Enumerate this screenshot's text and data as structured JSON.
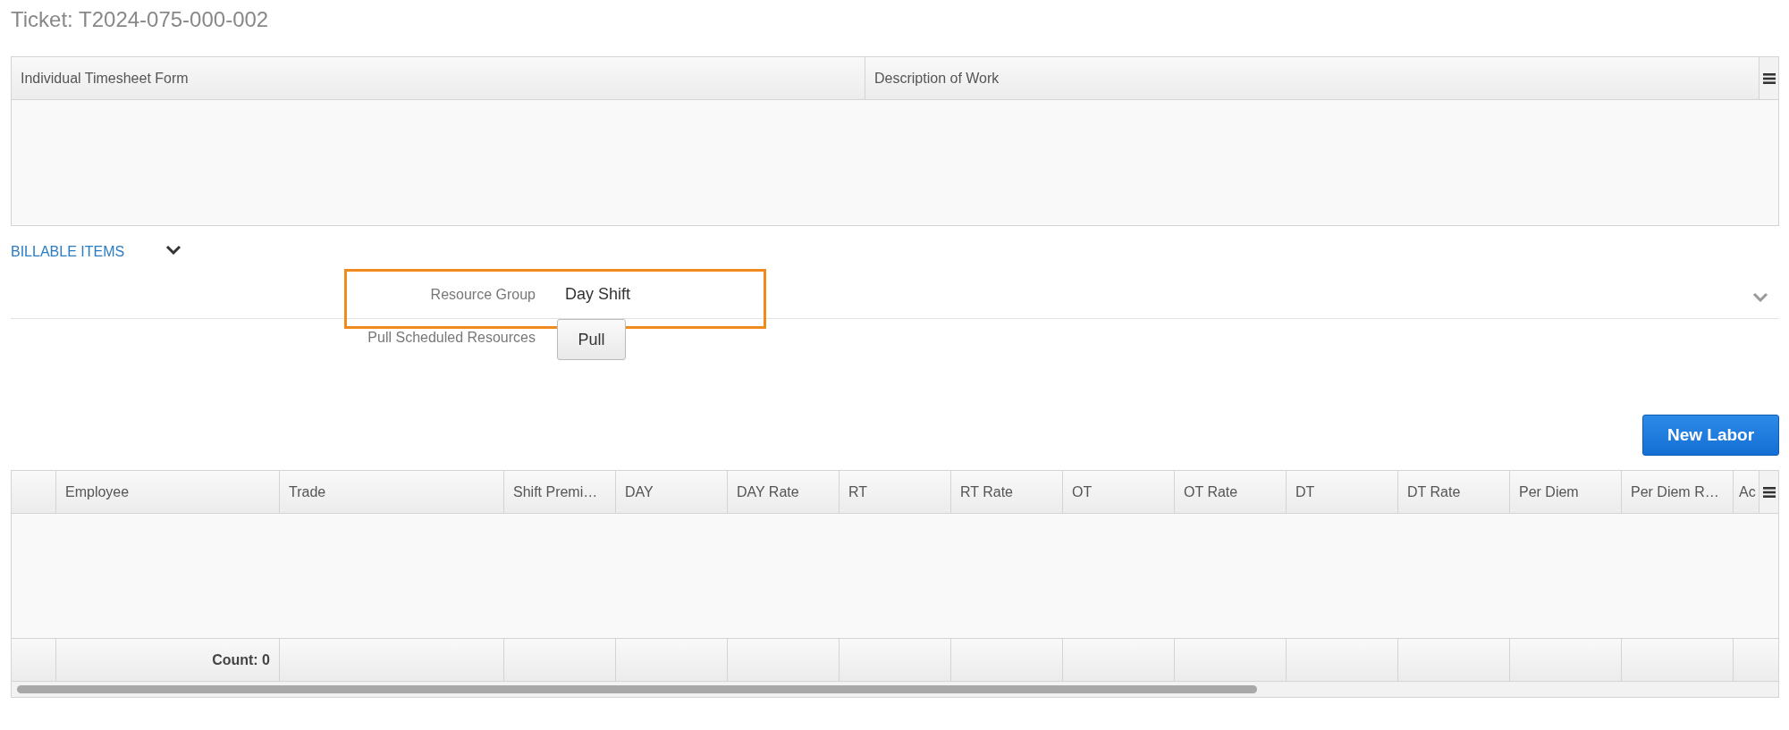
{
  "title": "Ticket: T2024-075-000-002",
  "form_grid": {
    "columns": [
      "Individual Timesheet Form",
      "Description of Work"
    ]
  },
  "billable_items": {
    "label": "BILLABLE ITEMS"
  },
  "resource_group": {
    "label": "Resource Group",
    "value": "Day Shift",
    "highlighted": true
  },
  "pull": {
    "label": "Pull Scheduled Resources",
    "button": "Pull"
  },
  "new_labor_button": "New Labor",
  "labor_grid": {
    "columns": [
      "Employee",
      "Trade",
      "Shift Premi…",
      "DAY",
      "DAY Rate",
      "RT",
      "RT Rate",
      "OT",
      "OT Rate",
      "DT",
      "DT Rate",
      "Per Diem",
      "Per Diem R…",
      "Ac"
    ],
    "footer": {
      "count": "Count: 0"
    }
  }
}
